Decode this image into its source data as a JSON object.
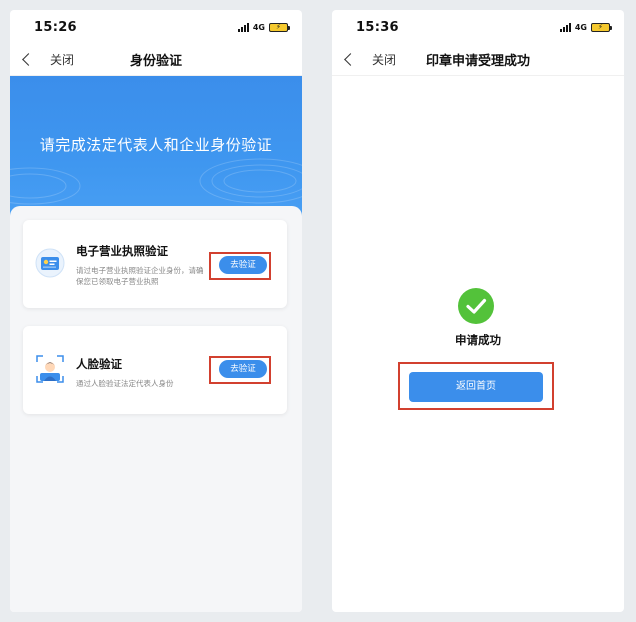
{
  "screens": [
    {
      "status": {
        "time": "15:26",
        "network": "4G"
      },
      "nav": {
        "close_label": "关闭",
        "title": "身份验证"
      },
      "banner": {
        "text": "请完成法定代表人和企业身份验证"
      },
      "cards": [
        {
          "title": "电子营业执照验证",
          "desc": "请过电子营业执照验证企业身份，请确保您已领取电子营业执照",
          "button": "去验证",
          "icon": "id-card-icon"
        },
        {
          "title": "人脸验证",
          "desc": "通过人脸验证法定代表人身份",
          "button": "去验证",
          "icon": "face-scan-icon"
        }
      ]
    },
    {
      "status": {
        "time": "15:36",
        "network": "4G"
      },
      "nav": {
        "close_label": "关闭",
        "title": "印章申请受理成功"
      },
      "result": {
        "text": "申请成功",
        "button": "返回首页",
        "icon": "check-circle-icon"
      }
    }
  ],
  "colors": {
    "primary": "#3b8eeb",
    "success": "#53c23a",
    "highlight": "#d2402f"
  }
}
